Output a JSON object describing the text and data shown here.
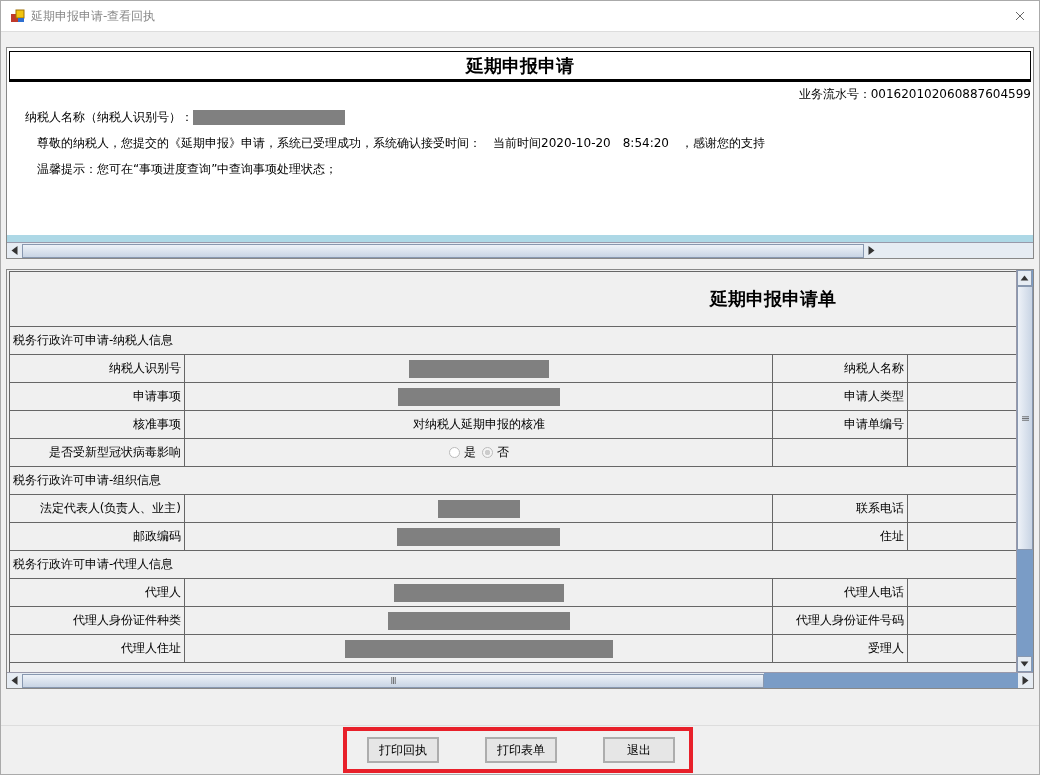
{
  "window": {
    "title": "延期申报申请-查看回执"
  },
  "receipt": {
    "title": "延期申报申请",
    "serial_label": "业务流水号：",
    "serial": "001620102060887604599",
    "taxpayer_label": "纳税人名称（纳税人识别号）：",
    "taxpayer_redacted": true,
    "message": "尊敬的纳税人，您提交的《延期申报》申请，系统已受理成功，系统确认接受时间：　当前时间2020-10-20　8:54:20　，感谢您的支持",
    "tip": "温馨提示：您可在“事项进度查询”中查询事项处理状态；"
  },
  "form": {
    "title": "延期申报申请单",
    "rows": [
      {
        "kind": "section",
        "label": "税务行政许可申请-纳税人信息"
      },
      {
        "kind": "pair",
        "label": "纳税人识别号",
        "redacted": true,
        "label2": "纳税人名称"
      },
      {
        "kind": "pair",
        "label": "申请事项",
        "redacted": true,
        "label2": "申请人类型"
      },
      {
        "kind": "pair",
        "label": "核准事项",
        "value": "对纳税人延期申报的核准",
        "label2": "申请单编号"
      },
      {
        "kind": "radio",
        "label": "是否受新型冠状病毒影响",
        "options": [
          {
            "label": "是",
            "selected": false
          },
          {
            "label": "否",
            "selected": true
          }
        ]
      },
      {
        "kind": "section",
        "label": "税务行政许可申请-组织信息"
      },
      {
        "kind": "pair",
        "label": "法定代表人(负责人、业主)",
        "redacted": true,
        "label2": "联系电话"
      },
      {
        "kind": "pair",
        "label": "邮政编码",
        "redacted": true,
        "label2": "住址"
      },
      {
        "kind": "section",
        "label": "税务行政许可申请-代理人信息"
      },
      {
        "kind": "pair",
        "label": "代理人",
        "redacted": true,
        "label2": "代理人电话"
      },
      {
        "kind": "pair",
        "label": "代理人身份证件种类",
        "redacted": true,
        "label2": "代理人身份证件号码"
      },
      {
        "kind": "pair",
        "label": "代理人住址",
        "redacted": true,
        "label2": "受理人"
      }
    ]
  },
  "buttons": [
    "打印回执",
    "打印表单",
    "退出"
  ]
}
